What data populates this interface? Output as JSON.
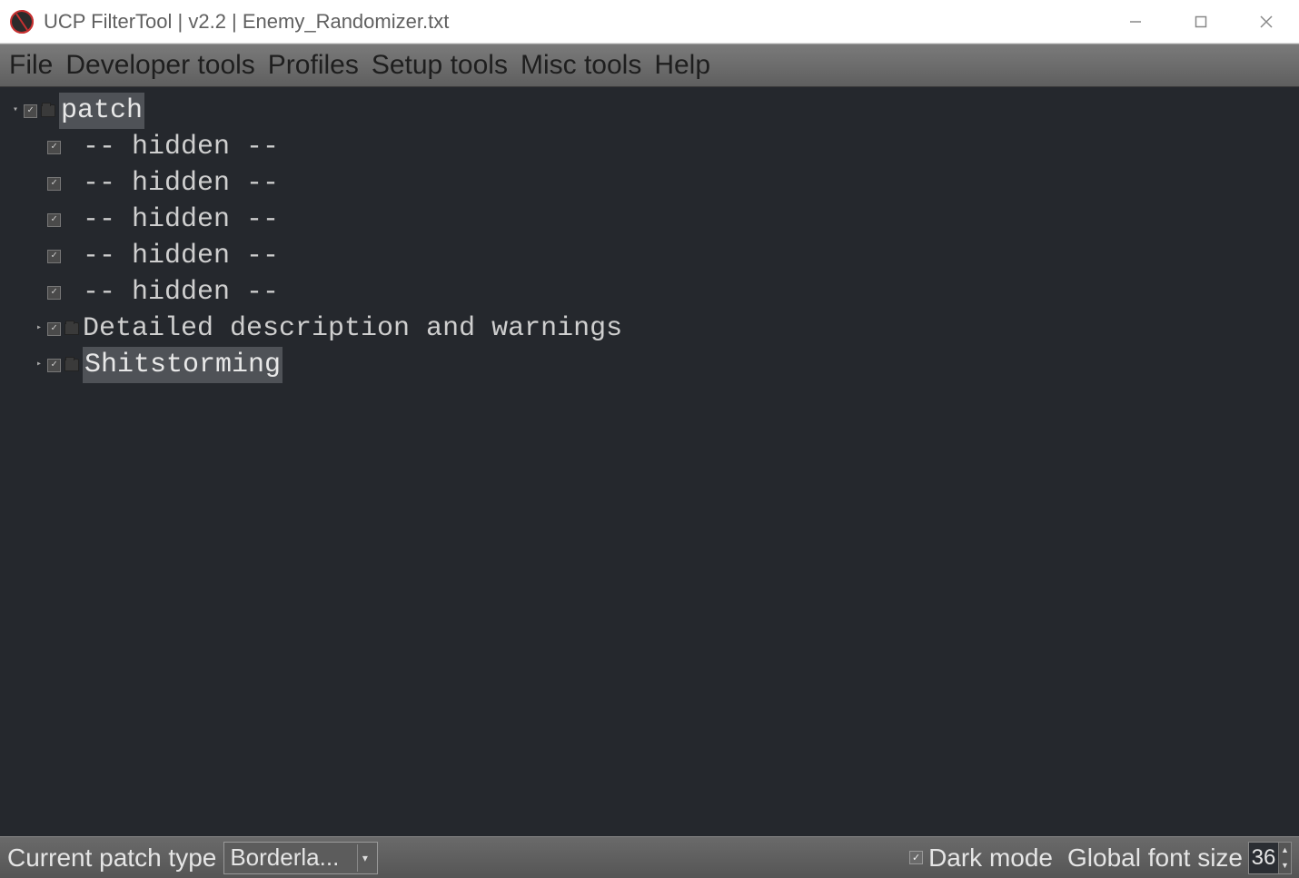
{
  "window": {
    "title": "UCP FilterTool | v2.2 | Enemy_Randomizer.txt"
  },
  "menubar": {
    "items": [
      "File",
      "Developer tools",
      "Profiles",
      "Setup tools",
      "Misc tools",
      "Help"
    ]
  },
  "tree": {
    "nodes": [
      {
        "depth": 0,
        "expander": "down",
        "checked": true,
        "folder": true,
        "label": "patch",
        "selected": true
      },
      {
        "depth": 1,
        "expander": "none",
        "checked": true,
        "folder": false,
        "label": "-- hidden --",
        "selected": false
      },
      {
        "depth": 1,
        "expander": "none",
        "checked": true,
        "folder": false,
        "label": "-- hidden --",
        "selected": false
      },
      {
        "depth": 1,
        "expander": "none",
        "checked": true,
        "folder": false,
        "label": "-- hidden --",
        "selected": false
      },
      {
        "depth": 1,
        "expander": "none",
        "checked": true,
        "folder": false,
        "label": "-- hidden --",
        "selected": false
      },
      {
        "depth": 1,
        "expander": "none",
        "checked": true,
        "folder": false,
        "label": "-- hidden --",
        "selected": false
      },
      {
        "depth": 1,
        "expander": "right",
        "checked": true,
        "folder": true,
        "label": "Detailed description and warnings",
        "selected": false
      },
      {
        "depth": 1,
        "expander": "right",
        "checked": true,
        "folder": true,
        "label": "Shitstorming",
        "selected": true
      }
    ]
  },
  "statusbar": {
    "patch_type_label": "Current patch type",
    "patch_type_value": "Borderla...",
    "dark_mode_label": "Dark mode",
    "dark_mode_checked": true,
    "font_size_label": "Global font size",
    "font_size_value": "36"
  }
}
